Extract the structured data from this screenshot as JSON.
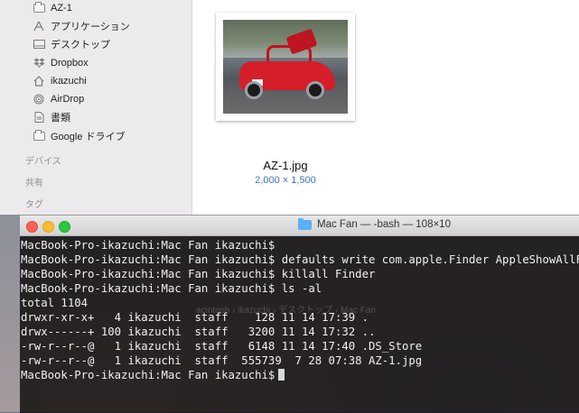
{
  "finder": {
    "sidebar": {
      "items": [
        {
          "label": "AZ-1",
          "icon": "folder-icon"
        },
        {
          "label": "アプリケーション",
          "icon": "applications-icon"
        },
        {
          "label": "デスクトップ",
          "icon": "desktop-icon"
        },
        {
          "label": "Dropbox",
          "icon": "dropbox-icon"
        },
        {
          "label": "ikazuchi",
          "icon": "home-icon"
        },
        {
          "label": "AirDrop",
          "icon": "airdrop-icon"
        },
        {
          "label": "書類",
          "icon": "documents-icon"
        },
        {
          "label": "Google ドライブ",
          "icon": "folder-icon"
        }
      ],
      "sections": [
        "デバイス",
        "共有",
        "タグ"
      ]
    },
    "preview": {
      "filename": "AZ-1.jpg",
      "dimensions": "2,000 × 1,500"
    }
  },
  "terminal": {
    "title": "Mac Fan — -bash — 108×10",
    "lines": [
      "MacBook-Pro-ikazuchi:Mac Fan ikazuchi$",
      "MacBook-Pro-ikazuchi:Mac Fan ikazuchi$ defaults write com.apple.Finder AppleShowAllFi",
      "MacBook-Pro-ikazuchi:Mac Fan ikazuchi$ killall Finder",
      "MacBook-Pro-ikazuchi:Mac Fan ikazuchi$ ls -al",
      "total 1104",
      "drwxr-xr-x+   4 ikazuchi  staff    128 11 14 17:39 .",
      "drwx------+ 100 ikazuchi  staff   3200 11 14 17:32 ..",
      "-rw-r--r--@   1 ikazuchi  staff   6148 11 14 17:40 .DS_Store",
      "-rw-r--r--@   1 ikazuchi  staff  555739  7 28 07:38 AZ-1.jpg",
      "MacBook-Pro-ikazuchi:Mac Fan ikazuchi$"
    ],
    "ghost_path": "acintosh  ›  ikazuchi  ›  デスクトップ  ›  Mac Fan"
  }
}
